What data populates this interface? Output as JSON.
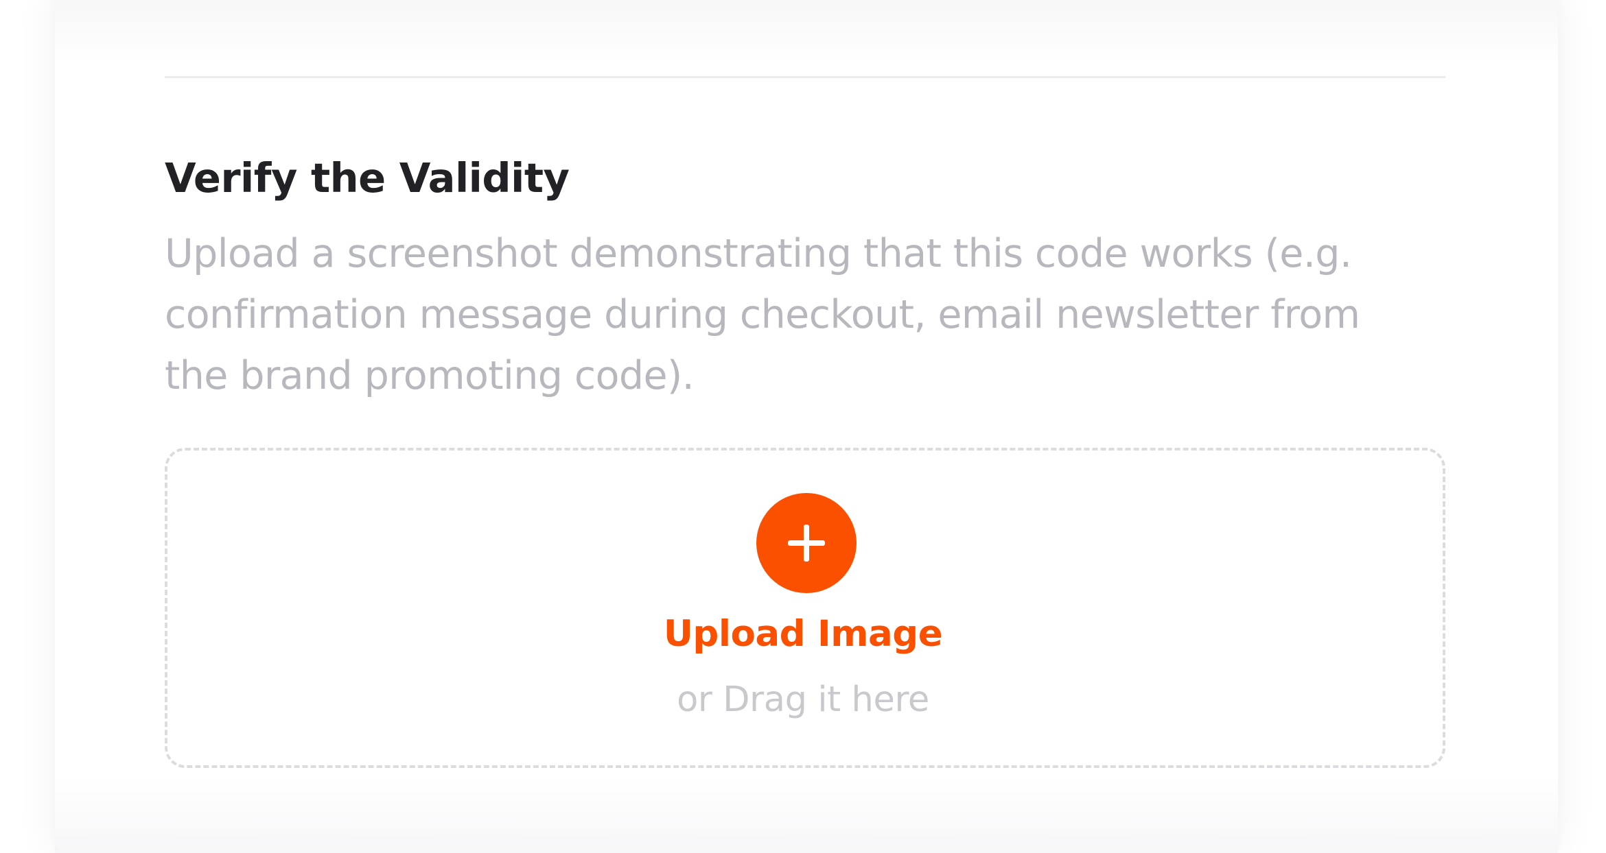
{
  "verify": {
    "title": "Verify the Validity",
    "description_lines": [
      "Upload a screenshot demonstrating that this code works (e.g.",
      "confirmation message during checkout, email newsletter from",
      "the brand promoting code)."
    ]
  },
  "upload": {
    "icon": "plus-icon",
    "label": "Upload Image",
    "hint": "or Drag it here"
  },
  "colors": {
    "accent": "#fa5000",
    "title_text": "#222226",
    "muted_text": "#b7b7be",
    "dropzone_border": "#dcdce0"
  }
}
